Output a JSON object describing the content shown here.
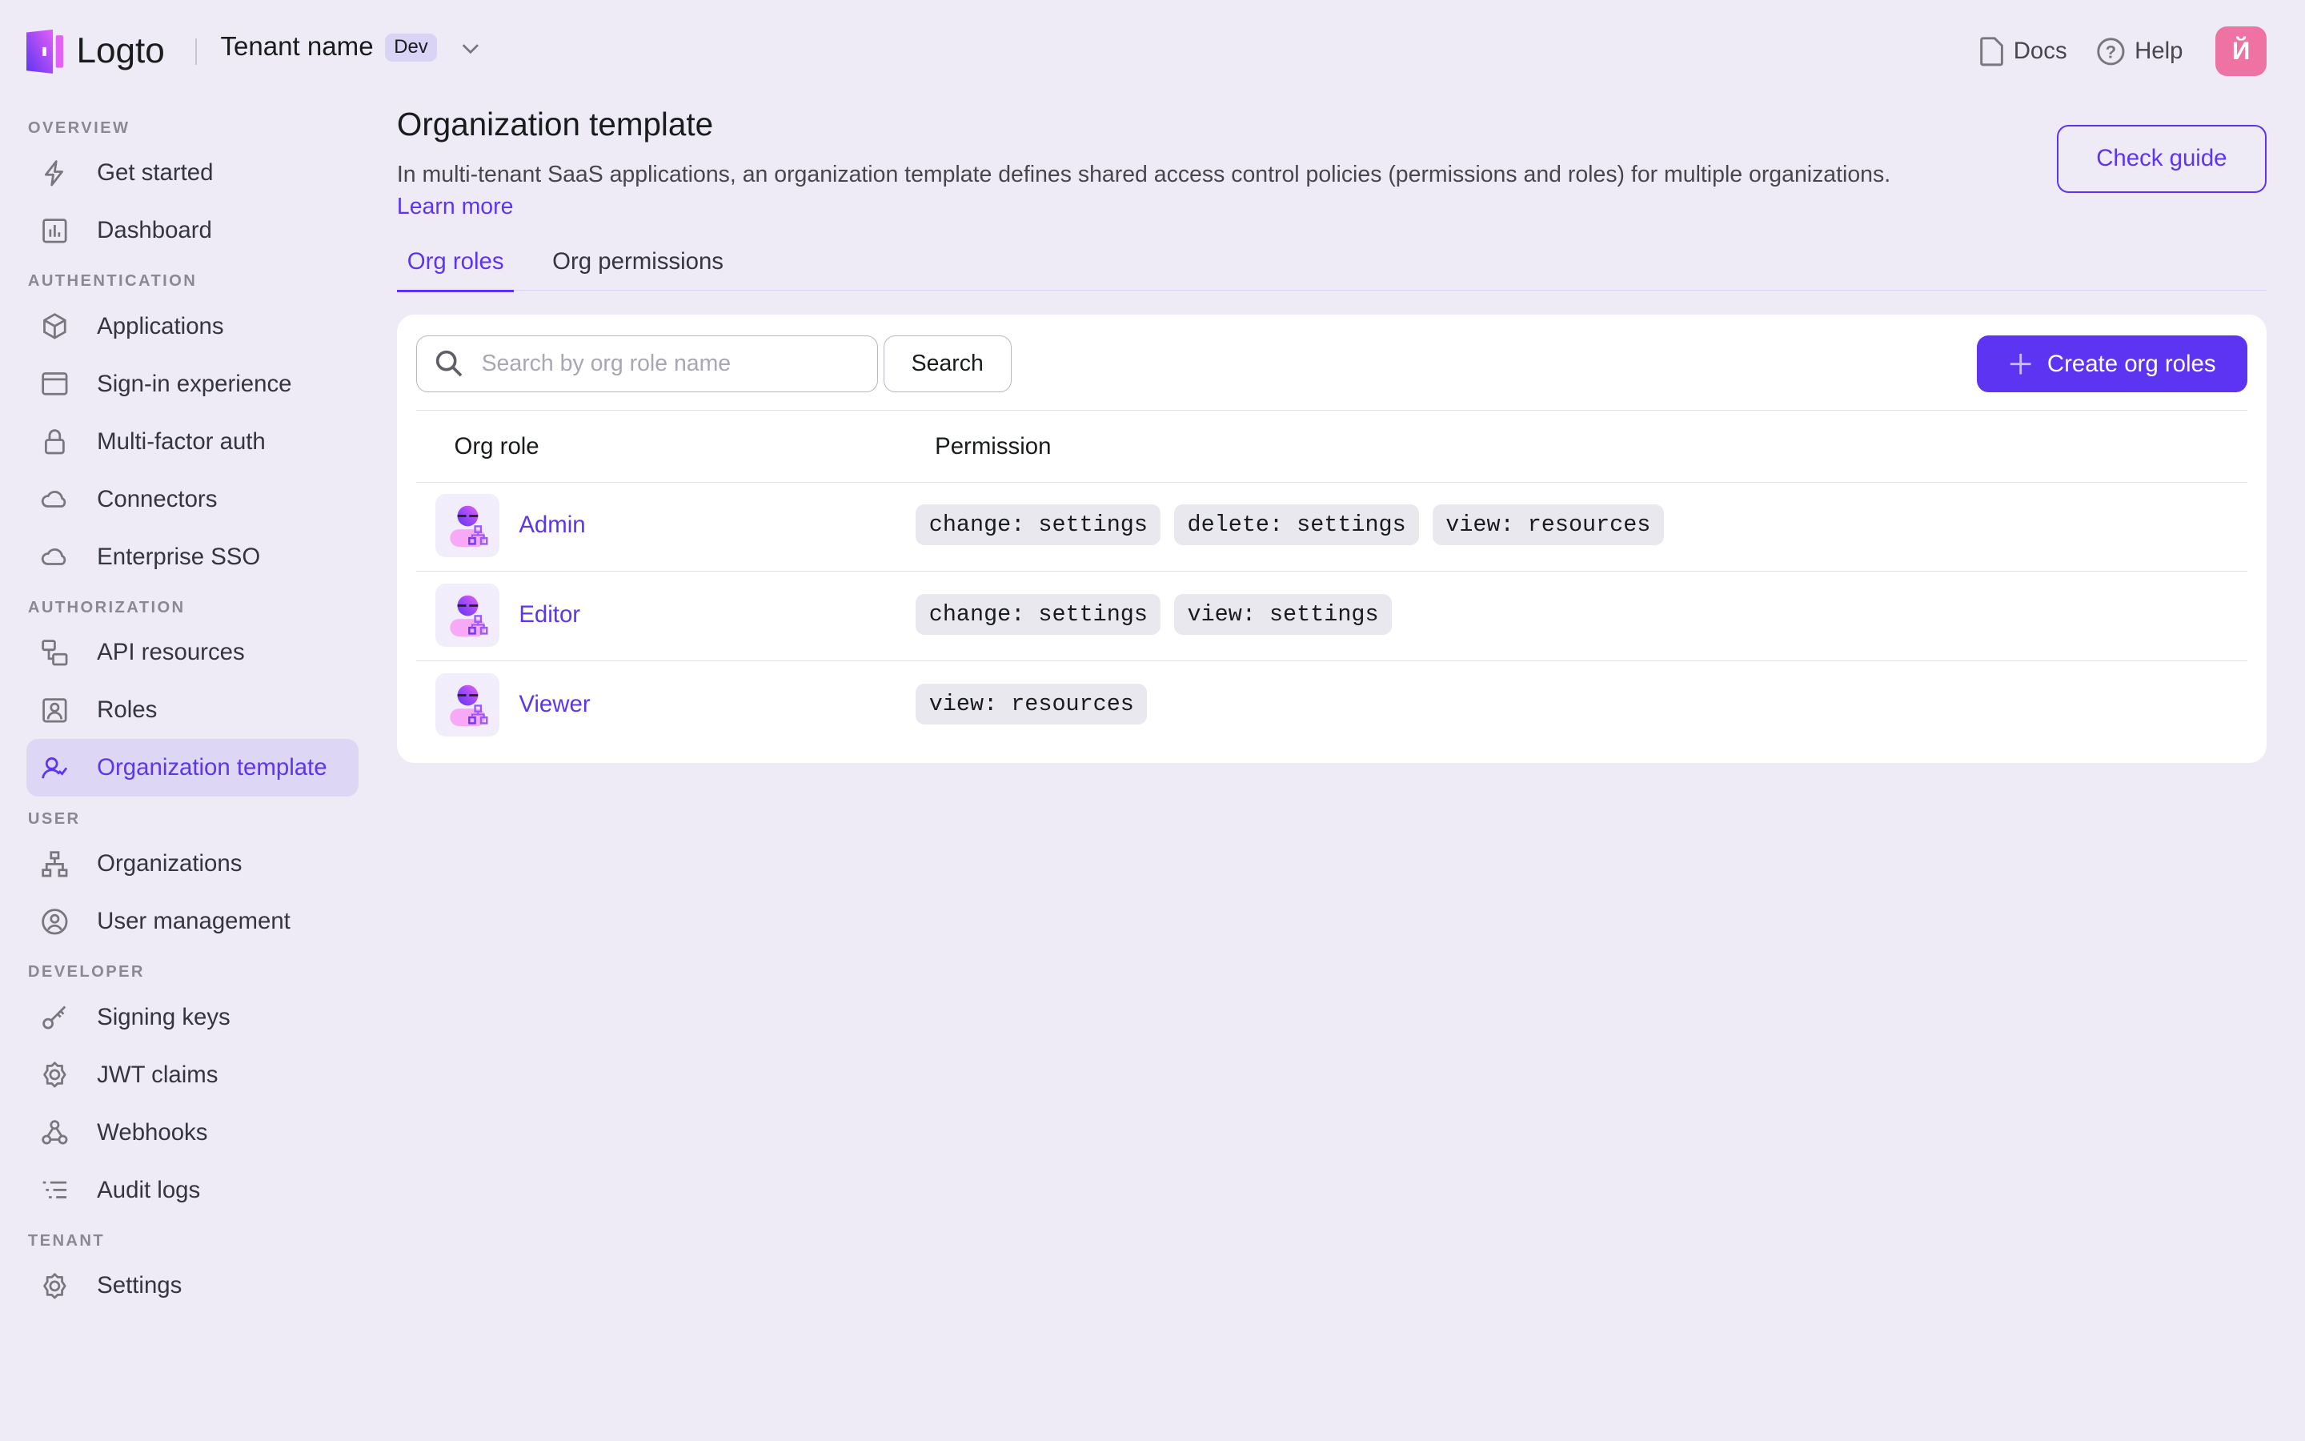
{
  "header": {
    "logo_text": "Logto",
    "tenant_name": "Tenant name",
    "tenant_badge": "Dev",
    "docs_label": "Docs",
    "help_label": "Help",
    "avatar_letter": "Й"
  },
  "sidebar": {
    "sections": [
      {
        "title": "OVERVIEW",
        "items": [
          {
            "label": "Get started",
            "icon": "bolt"
          },
          {
            "label": "Dashboard",
            "icon": "chart"
          }
        ]
      },
      {
        "title": "AUTHENTICATION",
        "items": [
          {
            "label": "Applications",
            "icon": "box"
          },
          {
            "label": "Sign-in experience",
            "icon": "window"
          },
          {
            "label": "Multi-factor auth",
            "icon": "lock"
          },
          {
            "label": "Connectors",
            "icon": "cloud"
          },
          {
            "label": "Enterprise SSO",
            "icon": "cloud"
          }
        ]
      },
      {
        "title": "AUTHORIZATION",
        "items": [
          {
            "label": "API resources",
            "icon": "api"
          },
          {
            "label": "Roles",
            "icon": "role"
          },
          {
            "label": "Organization template",
            "icon": "user-check",
            "active": true
          }
        ]
      },
      {
        "title": "USER",
        "items": [
          {
            "label": "Organizations",
            "icon": "org"
          },
          {
            "label": "User management",
            "icon": "user-circle"
          }
        ]
      },
      {
        "title": "DEVELOPER",
        "items": [
          {
            "label": "Signing keys",
            "icon": "key"
          },
          {
            "label": "JWT claims",
            "icon": "gear"
          },
          {
            "label": "Webhooks",
            "icon": "webhook"
          },
          {
            "label": "Audit logs",
            "icon": "list"
          }
        ]
      },
      {
        "title": "TENANT",
        "items": [
          {
            "label": "Settings",
            "icon": "gear"
          }
        ]
      }
    ]
  },
  "main": {
    "title": "Organization template",
    "description": "In multi-tenant SaaS applications, an organization template defines shared access control policies (permissions and roles) for multiple organizations.",
    "learn_more": "Learn more",
    "check_guide": "Check guide",
    "tabs": [
      {
        "label": "Org roles",
        "active": true
      },
      {
        "label": "Org permissions"
      }
    ],
    "search_placeholder": "Search by org role name",
    "search_button": "Search",
    "create_button": "Create org roles",
    "columns": [
      "Org role",
      "Permission"
    ],
    "rows": [
      {
        "name": "Admin",
        "permissions": [
          "change: settings",
          "delete: settings",
          "view: resources"
        ]
      },
      {
        "name": "Editor",
        "permissions": [
          "change: settings",
          "view: settings"
        ]
      },
      {
        "name": "Viewer",
        "permissions": [
          "view: resources"
        ]
      }
    ]
  },
  "colors": {
    "accent": "#5d34f2",
    "avatar": "#ee73a2",
    "background": "#eeebf6"
  }
}
